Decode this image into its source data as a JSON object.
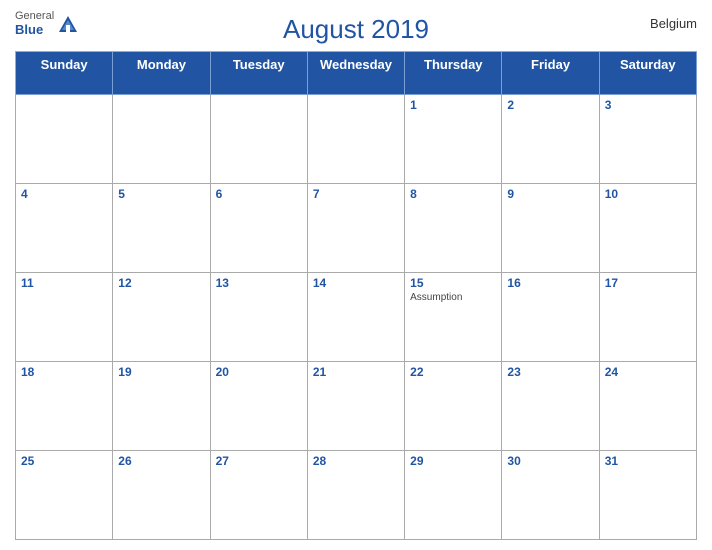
{
  "header": {
    "title": "August 2019",
    "country": "Belgium",
    "logo_general": "General",
    "logo_blue": "Blue"
  },
  "days_of_week": [
    "Sunday",
    "Monday",
    "Tuesday",
    "Wednesday",
    "Thursday",
    "Friday",
    "Saturday"
  ],
  "weeks": [
    [
      {
        "day": "",
        "event": ""
      },
      {
        "day": "",
        "event": ""
      },
      {
        "day": "",
        "event": ""
      },
      {
        "day": "",
        "event": ""
      },
      {
        "day": "1",
        "event": ""
      },
      {
        "day": "2",
        "event": ""
      },
      {
        "day": "3",
        "event": ""
      }
    ],
    [
      {
        "day": "4",
        "event": ""
      },
      {
        "day": "5",
        "event": ""
      },
      {
        "day": "6",
        "event": ""
      },
      {
        "day": "7",
        "event": ""
      },
      {
        "day": "8",
        "event": ""
      },
      {
        "day": "9",
        "event": ""
      },
      {
        "day": "10",
        "event": ""
      }
    ],
    [
      {
        "day": "11",
        "event": ""
      },
      {
        "day": "12",
        "event": ""
      },
      {
        "day": "13",
        "event": ""
      },
      {
        "day": "14",
        "event": ""
      },
      {
        "day": "15",
        "event": "Assumption"
      },
      {
        "day": "16",
        "event": ""
      },
      {
        "day": "17",
        "event": ""
      }
    ],
    [
      {
        "day": "18",
        "event": ""
      },
      {
        "day": "19",
        "event": ""
      },
      {
        "day": "20",
        "event": ""
      },
      {
        "day": "21",
        "event": ""
      },
      {
        "day": "22",
        "event": ""
      },
      {
        "day": "23",
        "event": ""
      },
      {
        "day": "24",
        "event": ""
      }
    ],
    [
      {
        "day": "25",
        "event": ""
      },
      {
        "day": "26",
        "event": ""
      },
      {
        "day": "27",
        "event": ""
      },
      {
        "day": "28",
        "event": ""
      },
      {
        "day": "29",
        "event": ""
      },
      {
        "day": "30",
        "event": ""
      },
      {
        "day": "31",
        "event": ""
      }
    ]
  ]
}
